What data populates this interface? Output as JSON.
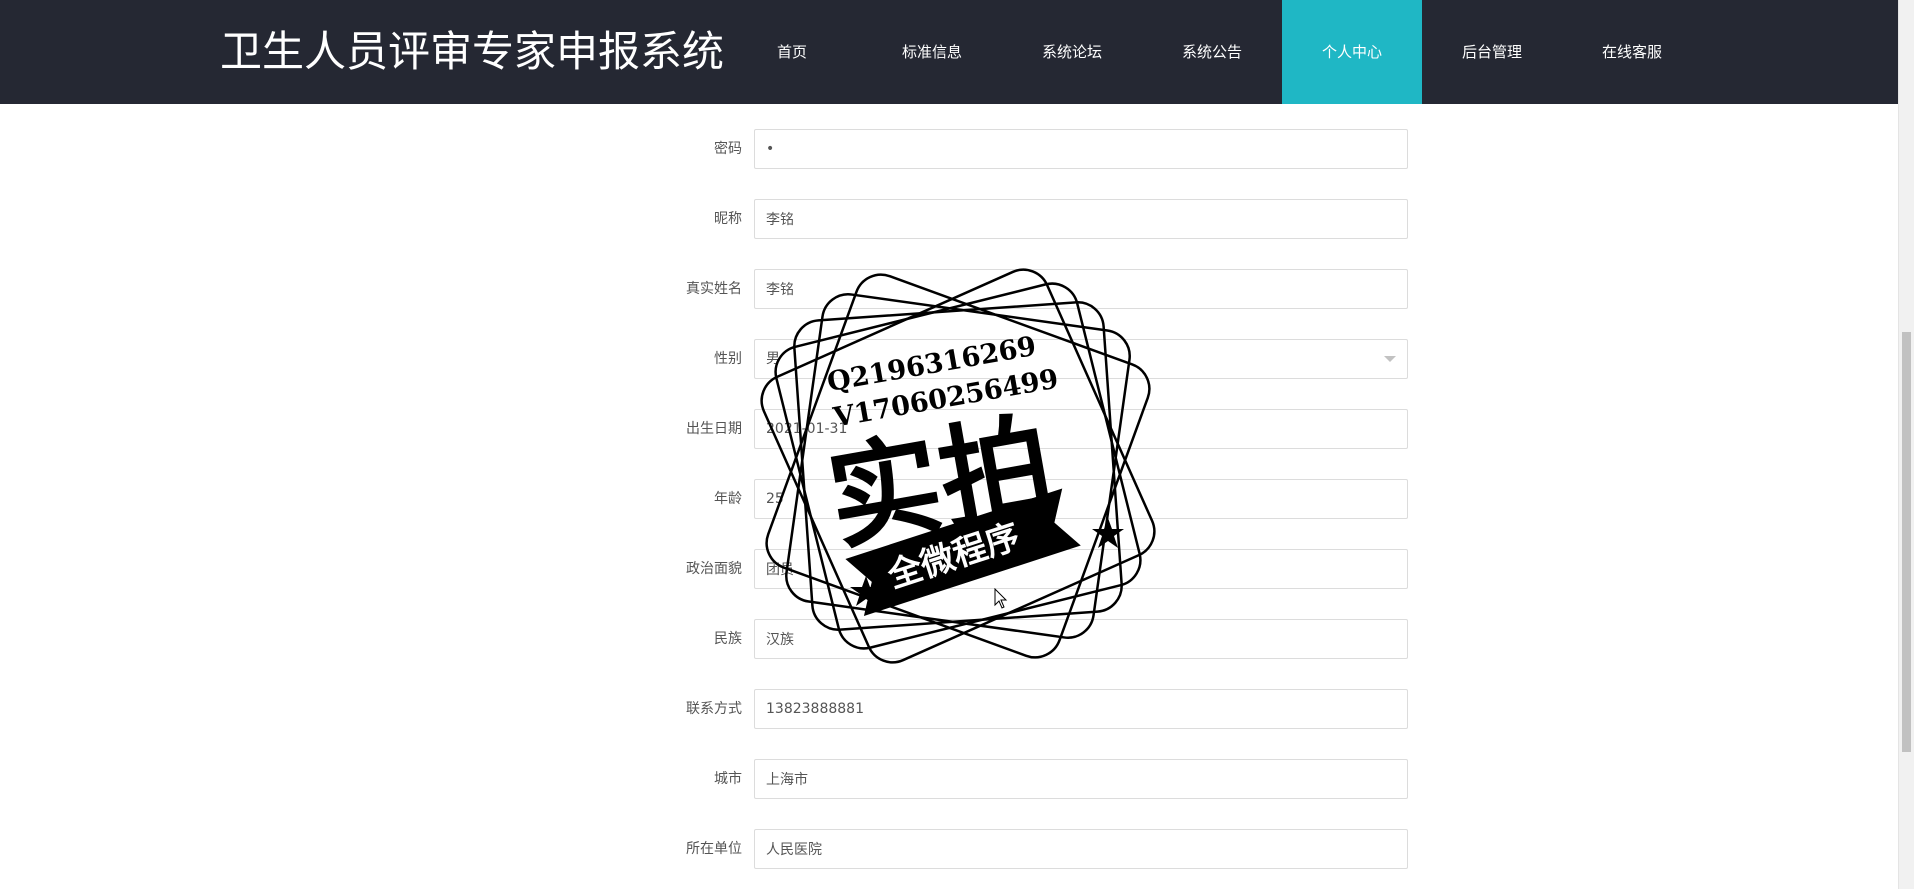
{
  "header": {
    "site_title": "卫生人员评审专家申报系统",
    "nav": [
      {
        "label": "首页",
        "active": false
      },
      {
        "label": "标准信息",
        "active": false
      },
      {
        "label": "系统论坛",
        "active": false
      },
      {
        "label": "系统公告",
        "active": false
      },
      {
        "label": "个人中心",
        "active": true
      },
      {
        "label": "后台管理",
        "active": false
      },
      {
        "label": "在线客服",
        "active": false
      }
    ]
  },
  "form": {
    "password": {
      "label": "密码",
      "value": "•"
    },
    "nickname": {
      "label": "昵称",
      "value": "李铭"
    },
    "real_name": {
      "label": "真实姓名",
      "value": "李铭"
    },
    "gender": {
      "label": "性别",
      "value": "男"
    },
    "birth_date": {
      "label": "出生日期",
      "value": "2021-01-31"
    },
    "age": {
      "label": "年龄",
      "value": "25"
    },
    "political": {
      "label": "政治面貌",
      "value": "团员"
    },
    "ethnicity": {
      "label": "民族",
      "value": "汉族"
    },
    "contact": {
      "label": "联系方式",
      "value": "13823888881"
    },
    "city": {
      "label": "城市",
      "value": "上海市"
    },
    "employer": {
      "label": "所在单位",
      "value": "人民医院"
    }
  },
  "watermark": {
    "line1": "Q2196316269",
    "line2": "V17060256499",
    "main": "实拍",
    "ribbon": "全微程序"
  },
  "colors": {
    "header_bg": "#252833",
    "nav_active_bg": "#1fb7c5",
    "field_border": "#dcdcdc"
  }
}
